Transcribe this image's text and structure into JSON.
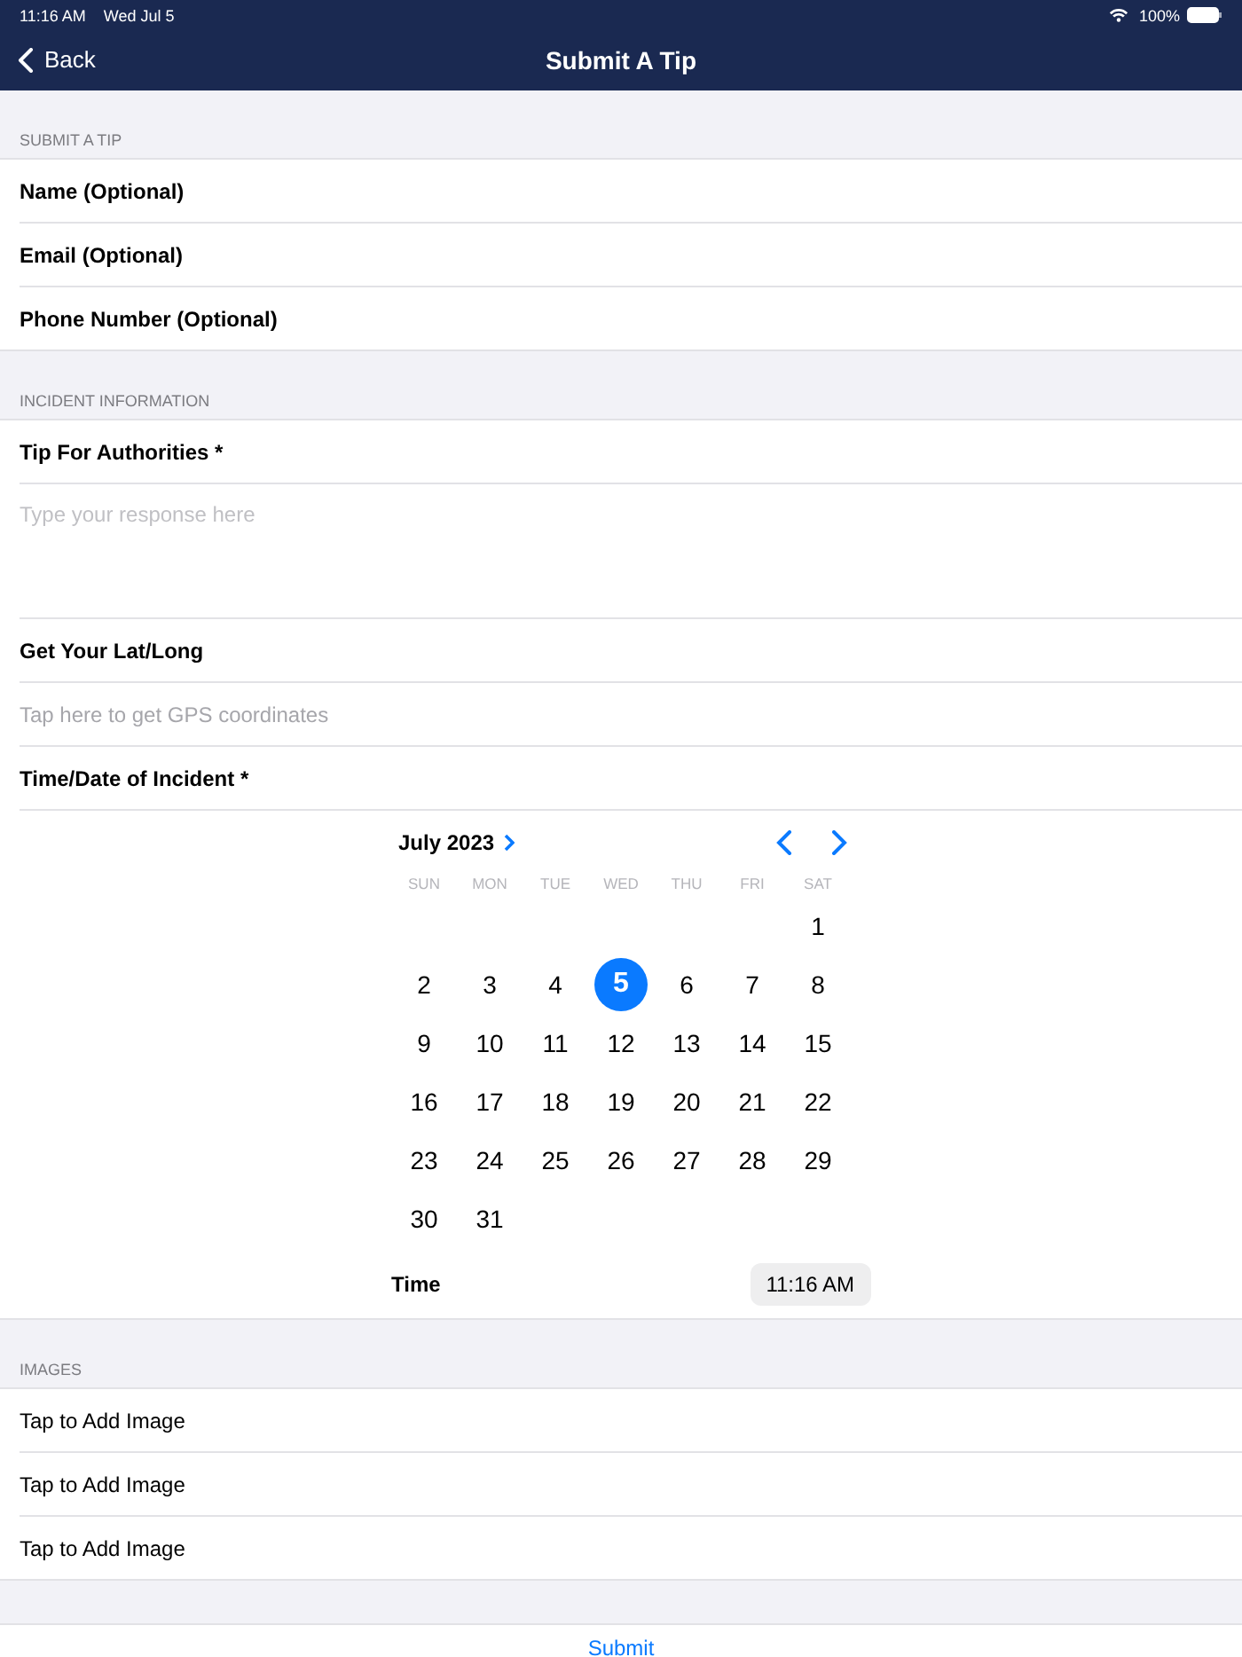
{
  "status_bar": {
    "time": "11:16 AM",
    "date": "Wed Jul 5",
    "battery": "100%"
  },
  "nav": {
    "back": "Back",
    "title": "Submit A Tip"
  },
  "sections": [
    {
      "header": "SUBMIT A TIP",
      "rows": [
        {
          "kind": "label",
          "text": "Name (Optional)"
        },
        {
          "kind": "label",
          "text": "Email (Optional)"
        },
        {
          "kind": "label",
          "text": "Phone Number (Optional)"
        }
      ]
    },
    {
      "header": "INCIDENT INFORMATION",
      "rows": [
        {
          "kind": "label",
          "text": "Tip For Authorities *"
        },
        {
          "kind": "textarea",
          "placeholder": "Type your response here"
        },
        {
          "kind": "label",
          "text": "Get Your Lat/Long"
        },
        {
          "kind": "hint",
          "text": "Tap here to get GPS coordinates"
        },
        {
          "kind": "label",
          "text": "Time/Date of Incident *"
        },
        {
          "kind": "calendar"
        }
      ]
    },
    {
      "header": "IMAGES",
      "rows": [
        {
          "kind": "action",
          "text": "Tap to Add Image"
        },
        {
          "kind": "action",
          "text": "Tap to Add Image"
        },
        {
          "kind": "action",
          "text": "Tap to Add Image"
        }
      ]
    }
  ],
  "calendar": {
    "month": "July 2023",
    "weekdays": [
      "SUN",
      "MON",
      "TUE",
      "WED",
      "THU",
      "FRI",
      "SAT"
    ],
    "weeks": [
      {
        "days": [
          {
            "label": "1",
            "selected": false
          }
        ]
      },
      {
        "days": [
          {
            "label": "2",
            "selected": false
          },
          {
            "label": "3",
            "selected": false
          },
          {
            "label": "4",
            "selected": false
          },
          {
            "label": "5",
            "selected": true
          },
          {
            "label": "6",
            "selected": false
          },
          {
            "label": "7",
            "selected": false
          },
          {
            "label": "8",
            "selected": false
          }
        ]
      },
      {
        "days": [
          {
            "label": "9",
            "selected": false
          },
          {
            "label": "10",
            "selected": false
          },
          {
            "label": "11",
            "selected": false
          },
          {
            "label": "12",
            "selected": false
          },
          {
            "label": "13",
            "selected": false
          },
          {
            "label": "14",
            "selected": false
          },
          {
            "label": "15",
            "selected": false
          }
        ]
      },
      {
        "days": [
          {
            "label": "16",
            "selected": false
          },
          {
            "label": "17",
            "selected": false
          },
          {
            "label": "18",
            "selected": false
          },
          {
            "label": "19",
            "selected": false
          },
          {
            "label": "20",
            "selected": false
          },
          {
            "label": "21",
            "selected": false
          },
          {
            "label": "22",
            "selected": false
          }
        ]
      },
      {
        "days": [
          {
            "label": "23",
            "selected": false
          },
          {
            "label": "24",
            "selected": false
          },
          {
            "label": "25",
            "selected": false
          },
          {
            "label": "26",
            "selected": false
          },
          {
            "label": "27",
            "selected": false
          },
          {
            "label": "28",
            "selected": false
          },
          {
            "label": "29",
            "selected": false
          }
        ]
      },
      {
        "days": [
          {
            "label": "30",
            "selected": false
          },
          {
            "label": "31",
            "selected": false
          }
        ]
      }
    ],
    "time_label": "Time",
    "time": "11:16 AM"
  },
  "submit": "Submit"
}
